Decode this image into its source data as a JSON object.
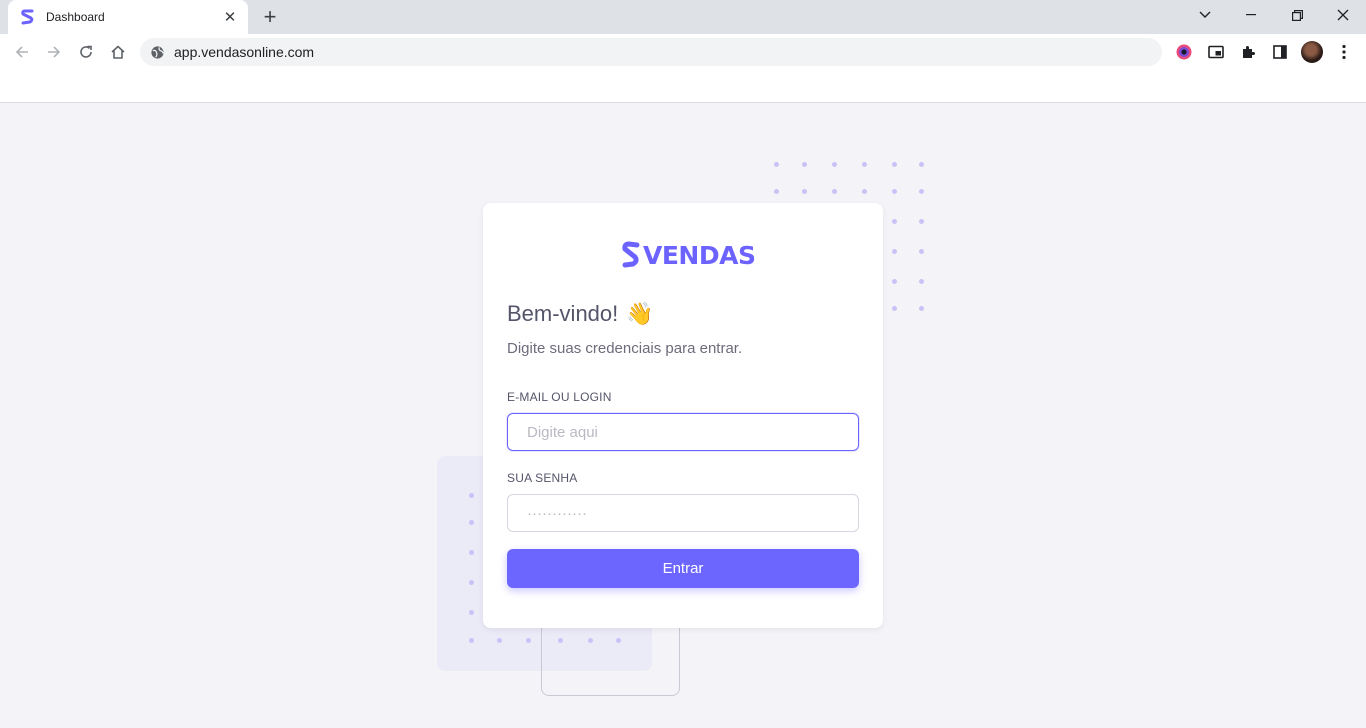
{
  "browser": {
    "tab_title": "Dashboard",
    "url": "app.vendasonline.com"
  },
  "login": {
    "logo_text": "VENDAS",
    "welcome": "Bem-vindo!",
    "wave_emoji": "👋",
    "subtitle": "Digite suas credenciais para entrar.",
    "email_label": "E-MAIL OU LOGIN",
    "email_placeholder": "Digite aqui",
    "password_label": "SUA SENHA",
    "password_placeholder": "············",
    "submit_label": "Entrar"
  },
  "colors": {
    "accent": "#6c63ff",
    "page_background": "#f4f4f8",
    "decor_dots": "#c9c2f7"
  }
}
